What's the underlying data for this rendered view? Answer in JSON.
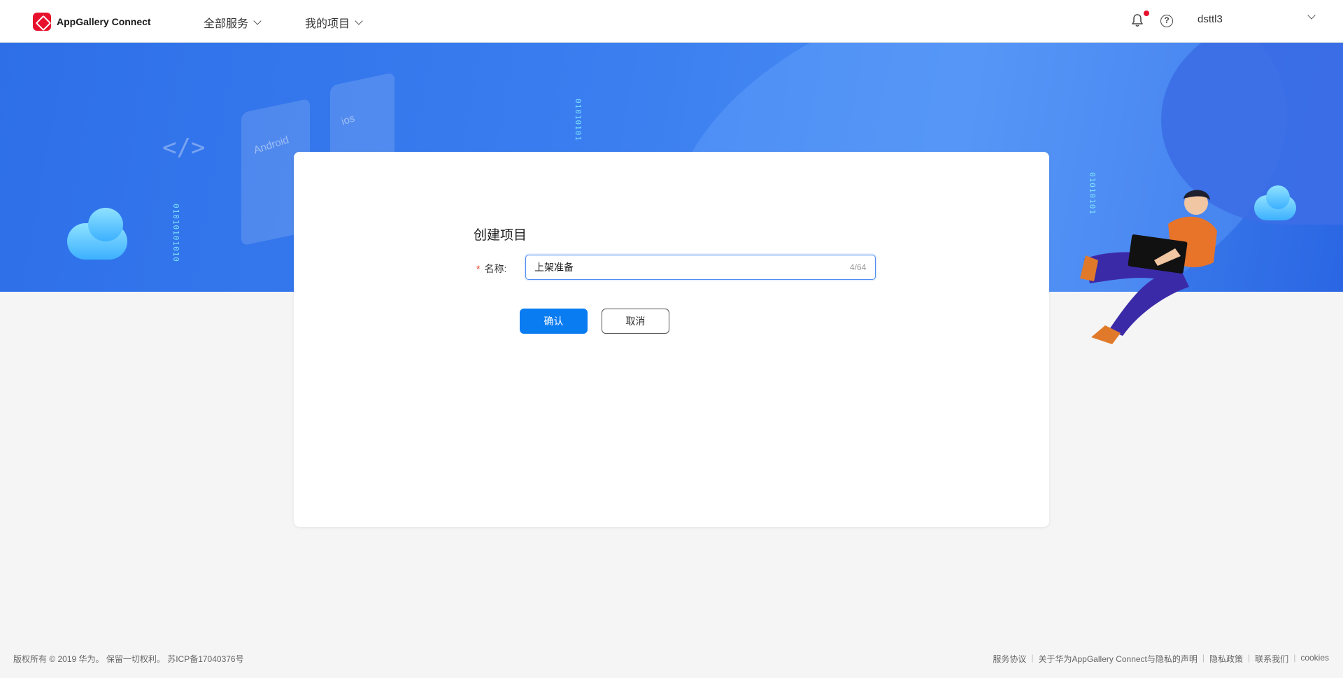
{
  "header": {
    "app_name": "AppGallery Connect",
    "nav": [
      {
        "label": "全部服务"
      },
      {
        "label": "我的项目"
      }
    ],
    "help_symbol": "?",
    "username": "dsttl3"
  },
  "banner": {
    "android_label": "Android",
    "ios_label": "ios",
    "code_glyph": "</>",
    "binary_strings": [
      "01010101010",
      "01010101",
      "01010101"
    ]
  },
  "dialog": {
    "title": "创建项目",
    "required_mark": "*",
    "name_label": "名称:",
    "name_value": "上架准备",
    "counter": "4/64",
    "confirm_label": "确认",
    "cancel_label": "取消"
  },
  "footer": {
    "copyright": "版权所有 © 2019 华为。 保留一切权利。 苏ICP备17040376号",
    "links": [
      "服务协议",
      "关于华为AppGallery Connect与隐私的声明",
      "隐私政策",
      "联系我们",
      "cookies"
    ]
  },
  "colors": {
    "primary": "#0a7cf2",
    "brand_red": "#e8112d",
    "banner_blue": "#3a7ef0"
  }
}
